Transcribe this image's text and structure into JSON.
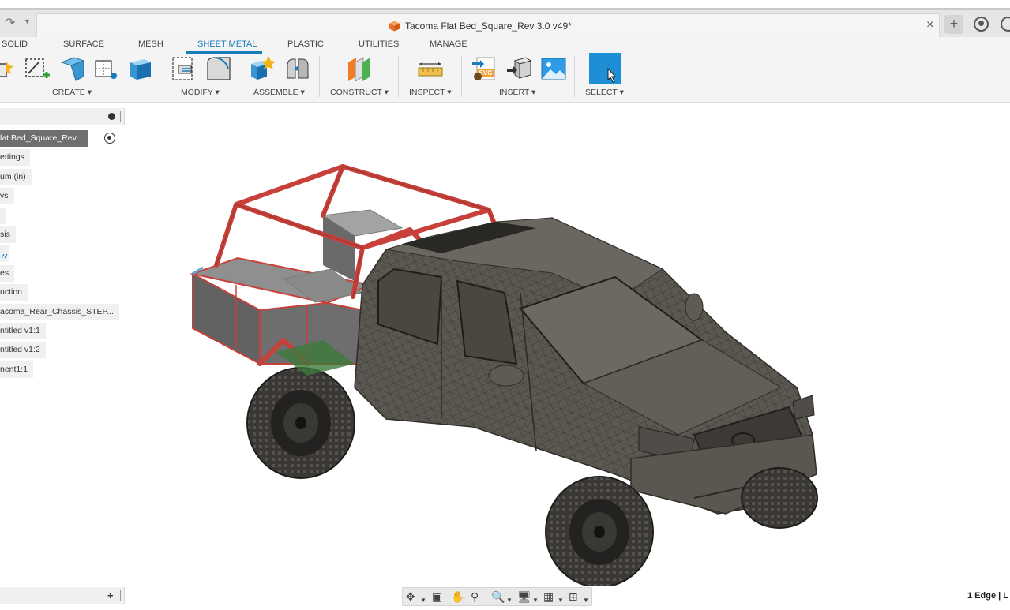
{
  "app": {
    "document_title": "Tacoma Flat Bed_Square_Rev 3.0 v49*"
  },
  "workspace_tabs": [
    {
      "label": "SOLID",
      "active": false
    },
    {
      "label": "SURFACE",
      "active": false
    },
    {
      "label": "MESH",
      "active": false
    },
    {
      "label": "SHEET METAL",
      "active": true
    },
    {
      "label": "PLASTIC",
      "active": false
    },
    {
      "label": "UTILITIES",
      "active": false
    },
    {
      "label": "MANAGE",
      "active": false
    }
  ],
  "ribbon_groups": [
    {
      "label": "CREATE ▾"
    },
    {
      "label": "MODIFY ▾"
    },
    {
      "label": "ASSEMBLE ▾"
    },
    {
      "label": "CONSTRUCT ▾"
    },
    {
      "label": "INSPECT ▾"
    },
    {
      "label": "INSERT ▾"
    },
    {
      "label": "SELECT ▾"
    }
  ],
  "browser": {
    "items": [
      {
        "label": "lat Bed_Square_Rev...",
        "selected": true
      },
      {
        "label": "ettings"
      },
      {
        "label": "um (in)"
      },
      {
        "label": "vs"
      },
      {
        "label": ""
      },
      {
        "label": "sis"
      },
      {
        "label": ""
      },
      {
        "label": "es"
      },
      {
        "label": "uction"
      },
      {
        "label": "acoma_Rear_Chassis_STEP..."
      },
      {
        "label": "ntitled v1:1"
      },
      {
        "label": "ntitled v1:2"
      },
      {
        "label": "nent1:1"
      }
    ]
  },
  "status": {
    "selection": "1 Edge | L"
  },
  "colors": {
    "accent": "#1a7bbd",
    "frame_red": "#c8403a",
    "body_grey": "#5b5751"
  }
}
